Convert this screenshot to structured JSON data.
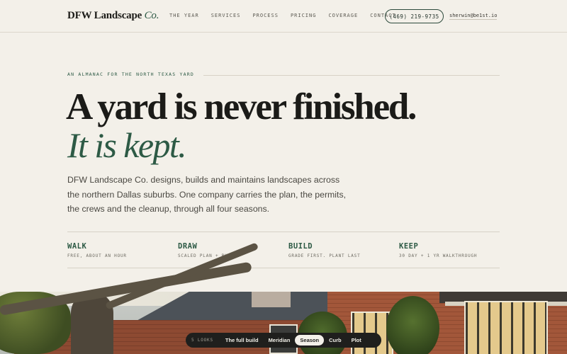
{
  "nav": {
    "brand_main": "DFW Landscape",
    "brand_accent": "Co.",
    "links": [
      "THE YEAR",
      "SERVICES",
      "PROCESS",
      "PRICING",
      "COVERAGE",
      "CONTACT"
    ],
    "phone": "(469) 219-9735",
    "email": "sherwin@be1st.io"
  },
  "hero": {
    "eyebrow": "AN ALMANAC FOR THE NORTH TEXAS YARD",
    "headline": "A yard is never finished.",
    "headline_accent": "It is kept.",
    "lede": "DFW Landscape Co. designs, builds and maintains landscapes across the northern Dallas suburbs. One company carries the plan, the permits, the crews and the cleanup, through all four seasons."
  },
  "steps": [
    {
      "title": "WALK",
      "subtitle": "FREE, ABOUT AN HOUR"
    },
    {
      "title": "DRAW",
      "subtitle": "SCALED PLAN + BUDGET"
    },
    {
      "title": "BUILD",
      "subtitle": "GRADE FIRST. PLANT LAST"
    },
    {
      "title": "KEEP",
      "subtitle": "30 DAY + 1 YR WALKTHROUGH"
    }
  ],
  "looks": {
    "label": "5 LOOKS",
    "options": [
      "The full build",
      "Meridian",
      "Season",
      "Curb",
      "Plot"
    ],
    "selected": "Season"
  },
  "colors": {
    "background": "#f3f0e9",
    "accent_green": "#2d5a45",
    "ink": "#1b1b18"
  }
}
